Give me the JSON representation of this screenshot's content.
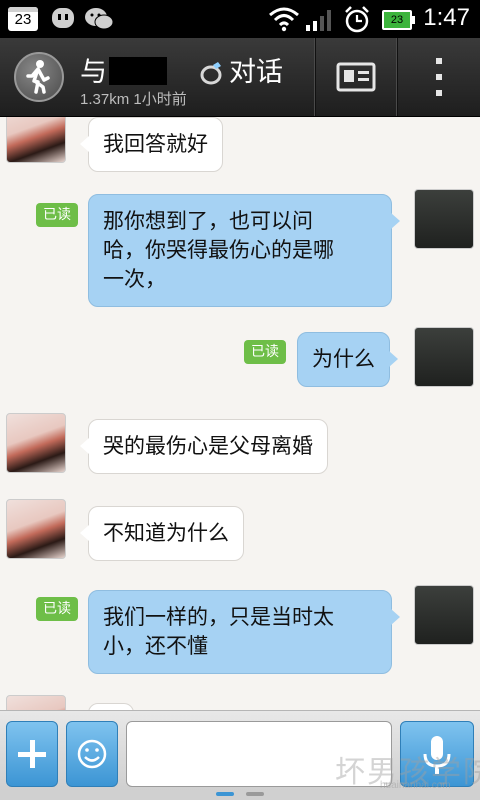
{
  "status_bar": {
    "calendar_day": "23",
    "battery_level": "23",
    "time": "1:47",
    "icons": [
      "calendar-icon",
      "talk-app-icon",
      "wechat-icon",
      "wifi-icon",
      "signal-icon",
      "alarm-icon",
      "battery-icon"
    ]
  },
  "header": {
    "title_prefix": "与",
    "title_suffix": "对话",
    "subtitle": "1.37km 1小时前",
    "icons": [
      "walk-icon",
      "ring-icon",
      "profile-card-icon",
      "more-icon"
    ]
  },
  "messages": [
    {
      "side": "in",
      "text": "我回答就好"
    },
    {
      "side": "out",
      "read": "已读",
      "lines": [
        "那你想到了，也可以问",
        "哈，你哭得最伤心的是哪",
        "一次，"
      ]
    },
    {
      "side": "out",
      "read": "已读",
      "text": "为什么"
    },
    {
      "side": "in",
      "text": "哭的最伤心是父母离婚"
    },
    {
      "side": "in",
      "text": "不知道为什么"
    },
    {
      "side": "out",
      "read": "已读",
      "lines": [
        "我们一样的，只是当时太",
        "小，还不懂"
      ]
    }
  ],
  "input_bar": {
    "message_value": "",
    "icons": [
      "plus-icon",
      "smiley-icon",
      "microphone-icon"
    ]
  },
  "watermark": {
    "text": "坏男孩学院",
    "url": "huainanhai.com"
  },
  "colors": {
    "outgoing_bubble": "#a6d2f3",
    "incoming_bubble": "#ffffff",
    "read_badge": "#6ebe48",
    "accent_button": "#3c95d4"
  }
}
